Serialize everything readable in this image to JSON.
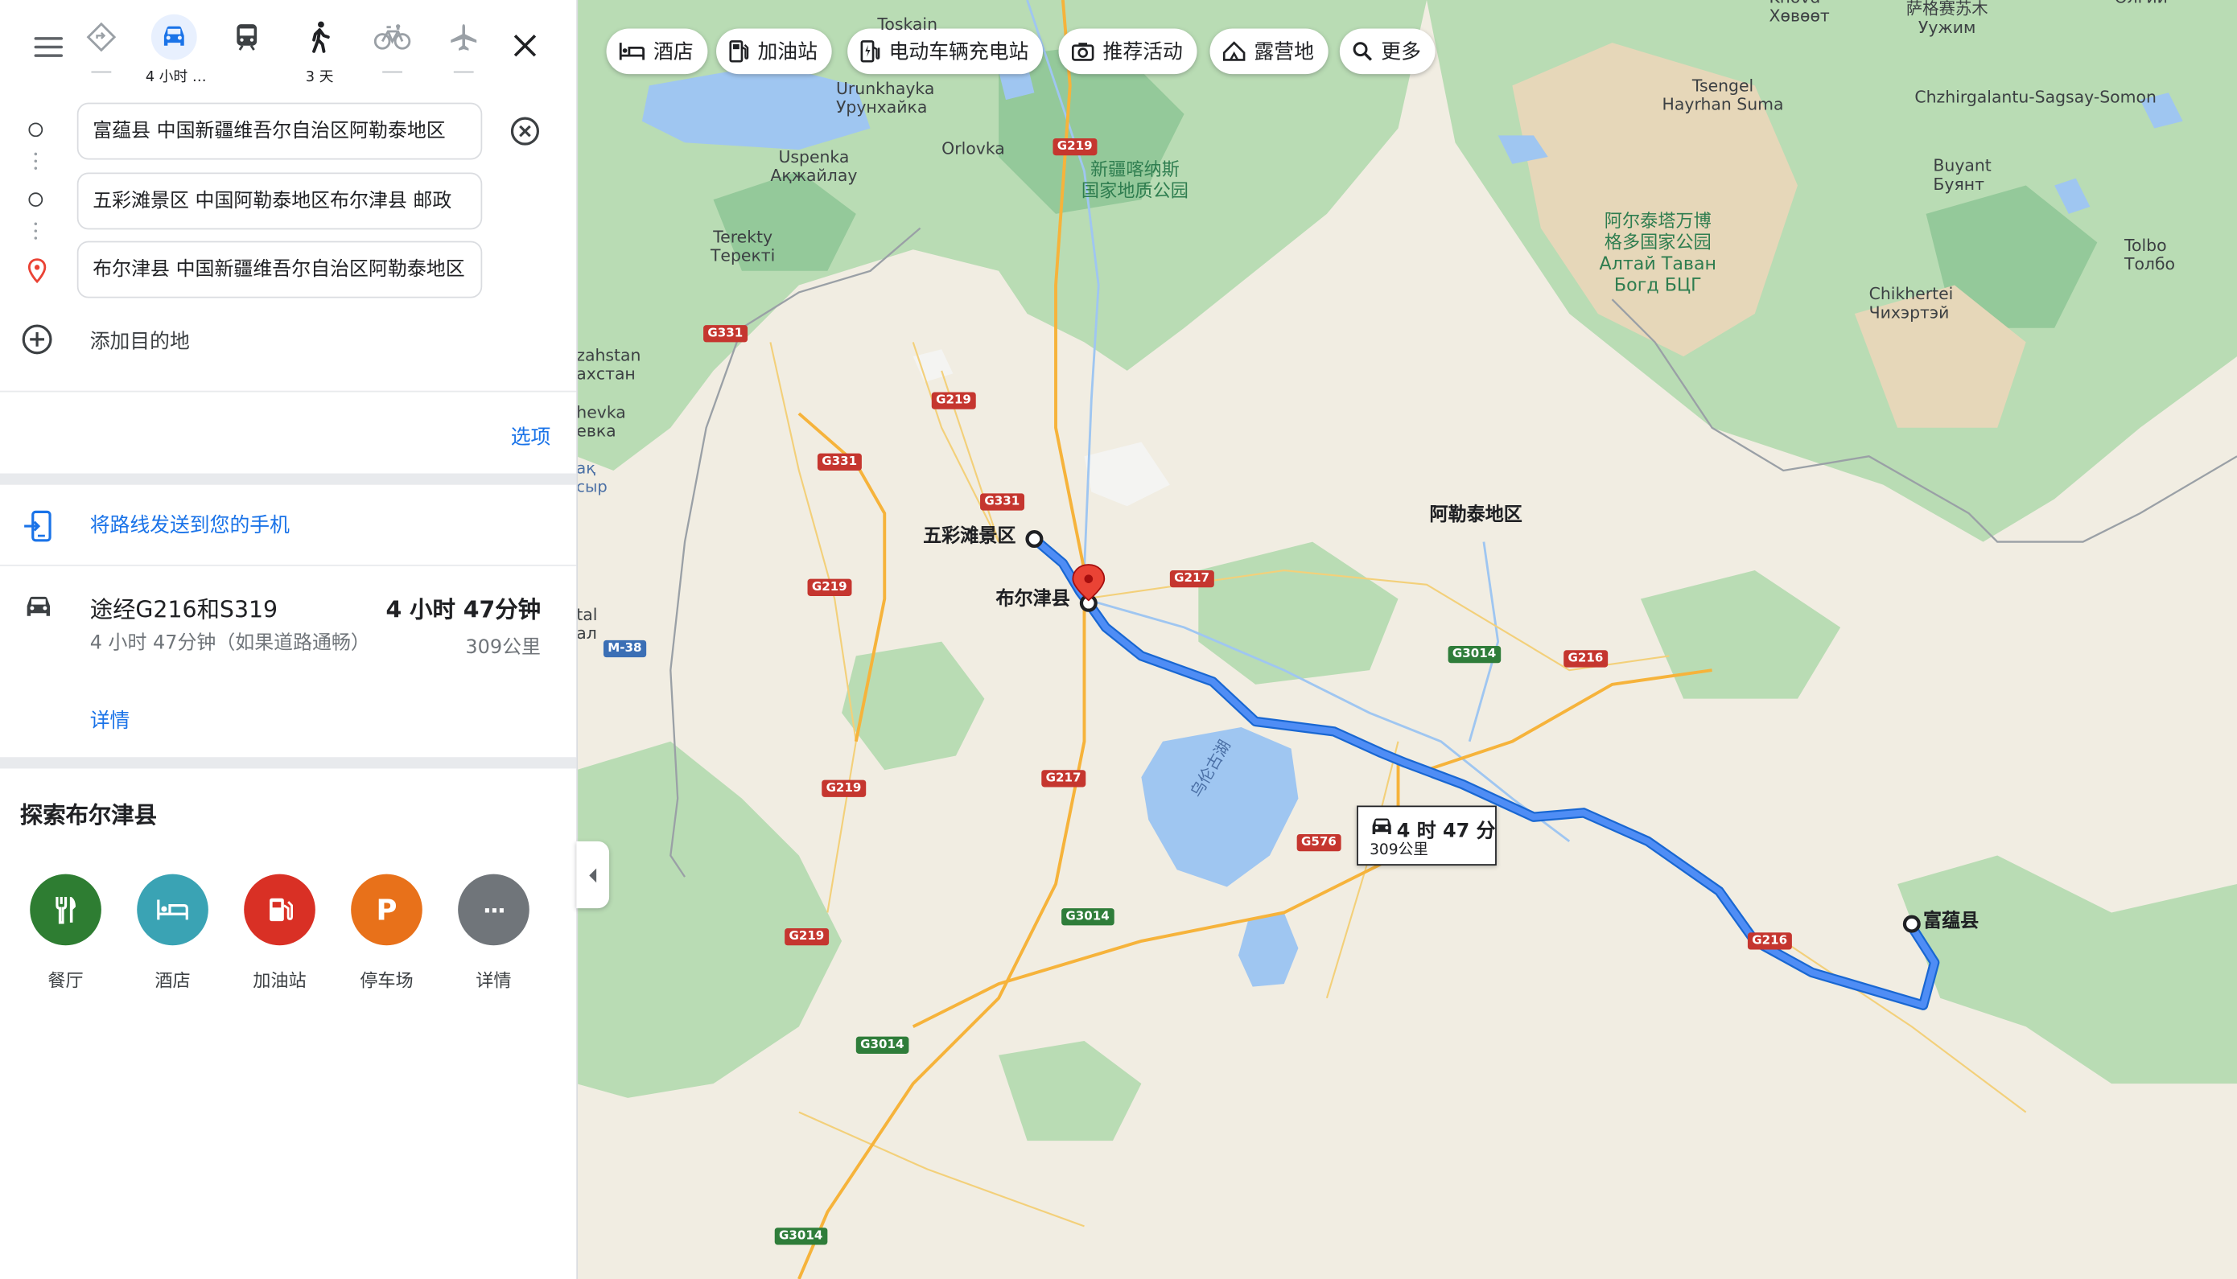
{
  "travel_modes": [
    {
      "name": "best",
      "label": "—"
    },
    {
      "name": "driving",
      "label": "4 小时 …"
    },
    {
      "name": "transit",
      "label": ""
    },
    {
      "name": "walking",
      "label": "3 天"
    },
    {
      "name": "cycling",
      "label": "—"
    },
    {
      "name": "flights",
      "label": "—"
    }
  ],
  "waypoints": {
    "origin": "富蕴县 中国新疆维吾尔自治区阿勒泰地区",
    "stop": "五彩滩景区 中国阿勒泰地区布尔津县 邮政",
    "destination": "布尔津县 中国新疆维吾尔自治区阿勒泰地区"
  },
  "add_destination": "添加目的地",
  "options_label": "选项",
  "send_to_phone": "将路线发送到您的手机",
  "route": {
    "via": "途经G216和S319",
    "duration": "4 小时 47分钟",
    "subtitle": "4 小时 47分钟（如果道路通畅）",
    "distance": "309公里",
    "details_link": "详情"
  },
  "explore": {
    "title": "探索布尔津县",
    "categories": [
      {
        "label": "餐厅",
        "icon": "restaurant-icon",
        "color": "#2e7d32"
      },
      {
        "label": "酒店",
        "icon": "hotel-icon",
        "color": "#3aa3b4"
      },
      {
        "label": "加油站",
        "icon": "gas-station-icon",
        "color": "#d93025"
      },
      {
        "label": "停车场",
        "icon": "parking-icon",
        "color": "#e8711a",
        "glyph": "P"
      },
      {
        "label": "详情",
        "icon": "more-icon",
        "color": "#70757a",
        "glyph": "···"
      }
    ]
  },
  "map_chips": [
    {
      "label": "酒店",
      "icon": "hotel-icon"
    },
    {
      "label": "加油站",
      "icon": "gas-station-icon"
    },
    {
      "label": "电动车辆充电站",
      "icon": "ev-charger-icon"
    },
    {
      "label": "推荐活动",
      "icon": "camera-icon"
    },
    {
      "label": "露营地",
      "icon": "camping-icon"
    },
    {
      "label": "更多",
      "icon": "search-icon"
    }
  ],
  "route_callout": {
    "duration": "4 时 47 分",
    "distance": "309公里"
  },
  "map_labels": {
    "toskain": "Toskain",
    "urunkhayka": "Urunkhayka\nУрунхайка",
    "uspenka": "Uspenka\nАқжайлау",
    "orlovka": "Orlovka",
    "terekty": "Terekty\nТеректі",
    "zahstan": "zahstan\nахстан",
    "evka": "hevka\nевка",
    "ak": "ақ\nсыр",
    "tal": "tal\nал",
    "kanas_park": "新疆喀纳斯\n国家地质公园",
    "altai_park": "阿尔泰塔万博\n格多国家公园\nАлтай Таван\nБогд БЦГ",
    "khovd": "Khovd\nХөвөөт",
    "sagsai": "萨格赛苏木\nУужим",
    "olgii": "Өлгий",
    "tsengel": "Tsengel\nHayrhan Suma",
    "chzhirgalantu": "Chzhirgalantu-Sagsay-Somon",
    "buyant": "Buyant\nБуянт",
    "tolbo": "Tolbo\nТолбо",
    "chikhertei": "Chikhertei\nЧихэртэй",
    "altay_prefecture": "阿勒泰地区",
    "wucaitan": "五彩滩景区",
    "burqin": "布尔津县",
    "fuyun": "富蕴县",
    "ulungur": "乌伦古湖"
  },
  "road_shields": {
    "g219": "G219",
    "g331": "G331",
    "g217": "G217",
    "g3014": "G3014",
    "g216": "G216",
    "g576": "G576",
    "m38": "M-38"
  },
  "colors": {
    "accent": "#1a73e8",
    "route": "#4285f4",
    "marker_red": "#ea4335",
    "forest": "#b9dcb4",
    "water": "#9fc6f1",
    "land": "#f1ede2"
  }
}
